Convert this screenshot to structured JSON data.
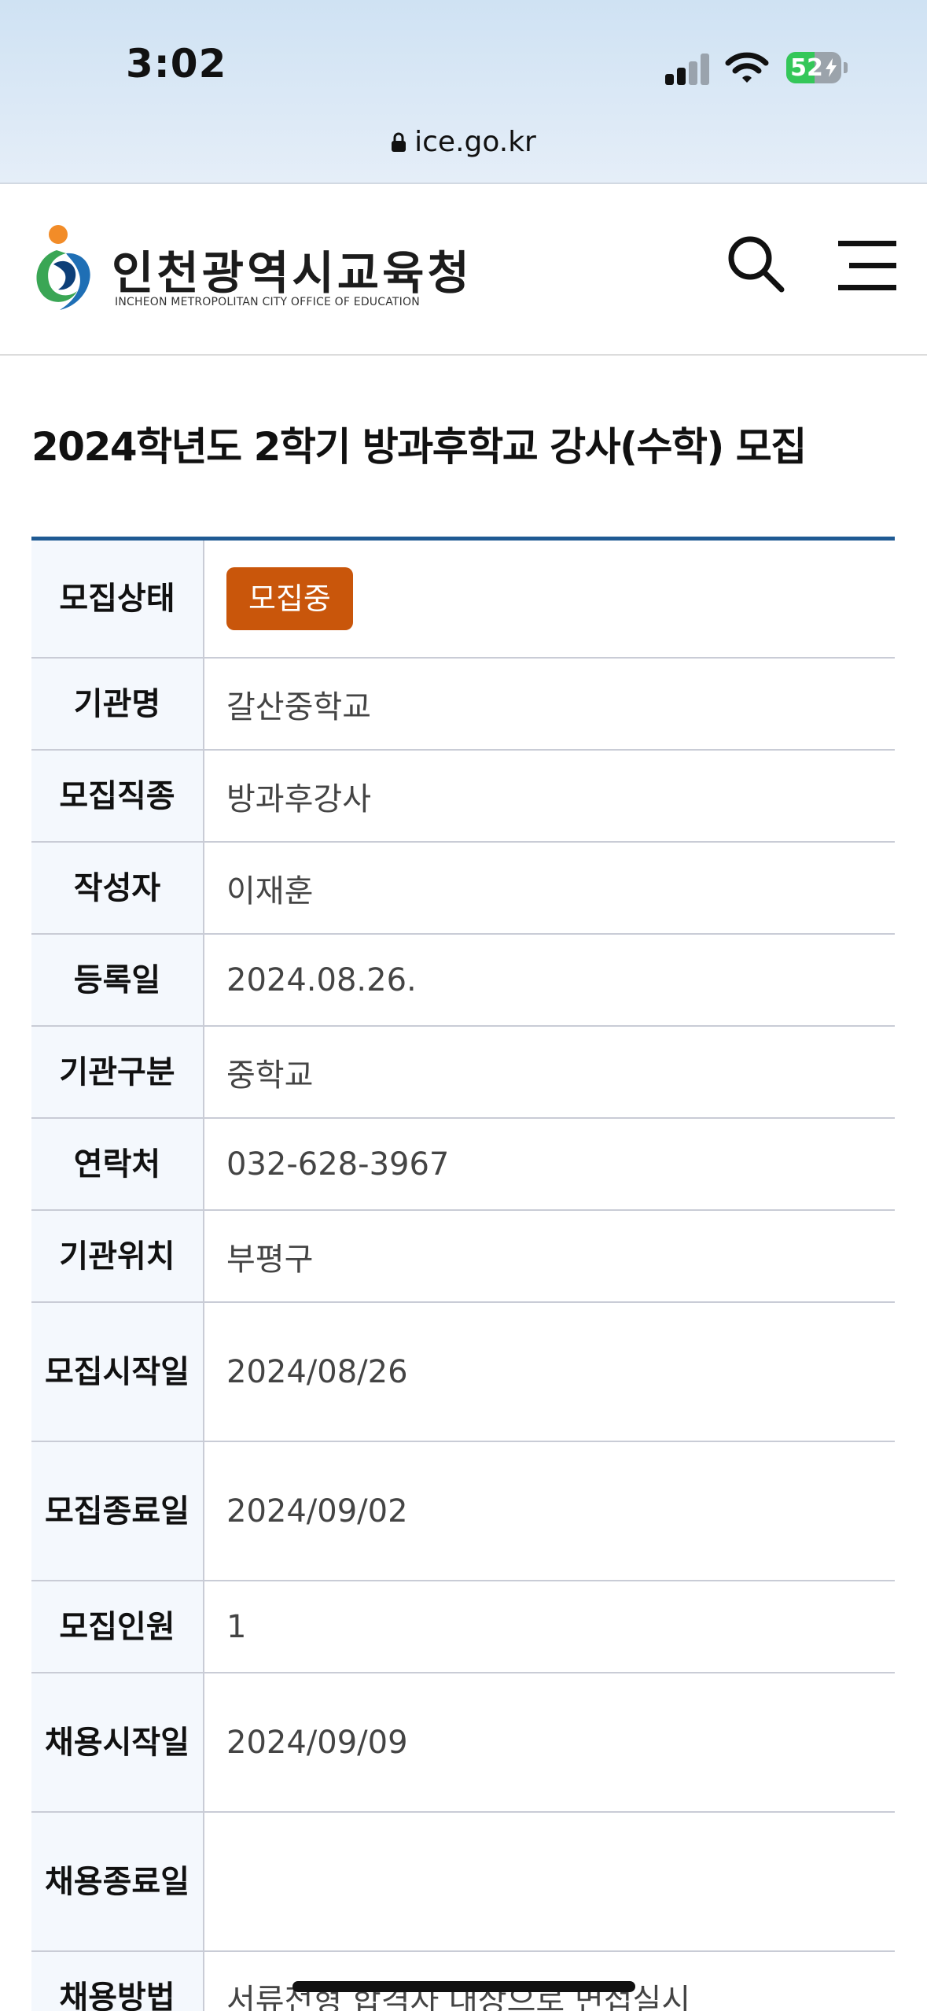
{
  "status_bar": {
    "time": "3:02",
    "battery_level": "52",
    "battery_fraction": 0.52,
    "signal_bars_active": 2,
    "signal_bars_total": 4
  },
  "browser": {
    "url": "ice.go.kr",
    "lock_icon": "lock-icon"
  },
  "header": {
    "logo_korean": "인천광역시교육청",
    "logo_english": "INCHEON METROPOLITAN CITY OFFICE OF EDUCATION",
    "search_icon": "search-icon",
    "menu_icon": "hamburger-menu-icon",
    "colors": {
      "logo_orange": "#f28c28",
      "logo_blue": "#1f6fb5",
      "logo_green": "#3aa655"
    }
  },
  "page": {
    "title": "2024학년도 2학기 방과후학교 강사(수학) 모집"
  },
  "table": {
    "accent_color": "#1f5a93",
    "badge_color": "#c9560b",
    "rows": [
      {
        "label": "모집상태",
        "value": "모집중",
        "badge": true
      },
      {
        "label": "기관명",
        "value": "갈산중학교"
      },
      {
        "label": "모집직종",
        "value": "방과후강사"
      },
      {
        "label": "작성자",
        "value": "이재훈"
      },
      {
        "label": "등록일",
        "value": "2024.08.26."
      },
      {
        "label": "기관구분",
        "value": "중학교"
      },
      {
        "label": "연락처",
        "value": "032-628-3967"
      },
      {
        "label": "기관위치",
        "value": "부평구"
      },
      {
        "label": "모집시작일",
        "value": "2024/08/26"
      },
      {
        "label": "모집종료일",
        "value": "2024/09/02"
      },
      {
        "label": "모집인원",
        "value": "1"
      },
      {
        "label": "채용시작일",
        "value": "2024/09/09"
      },
      {
        "label": "채용종료일",
        "value": ""
      },
      {
        "label": "채용방법",
        "value": "서류전형 합격자 대상으로 면접실시"
      }
    ]
  }
}
